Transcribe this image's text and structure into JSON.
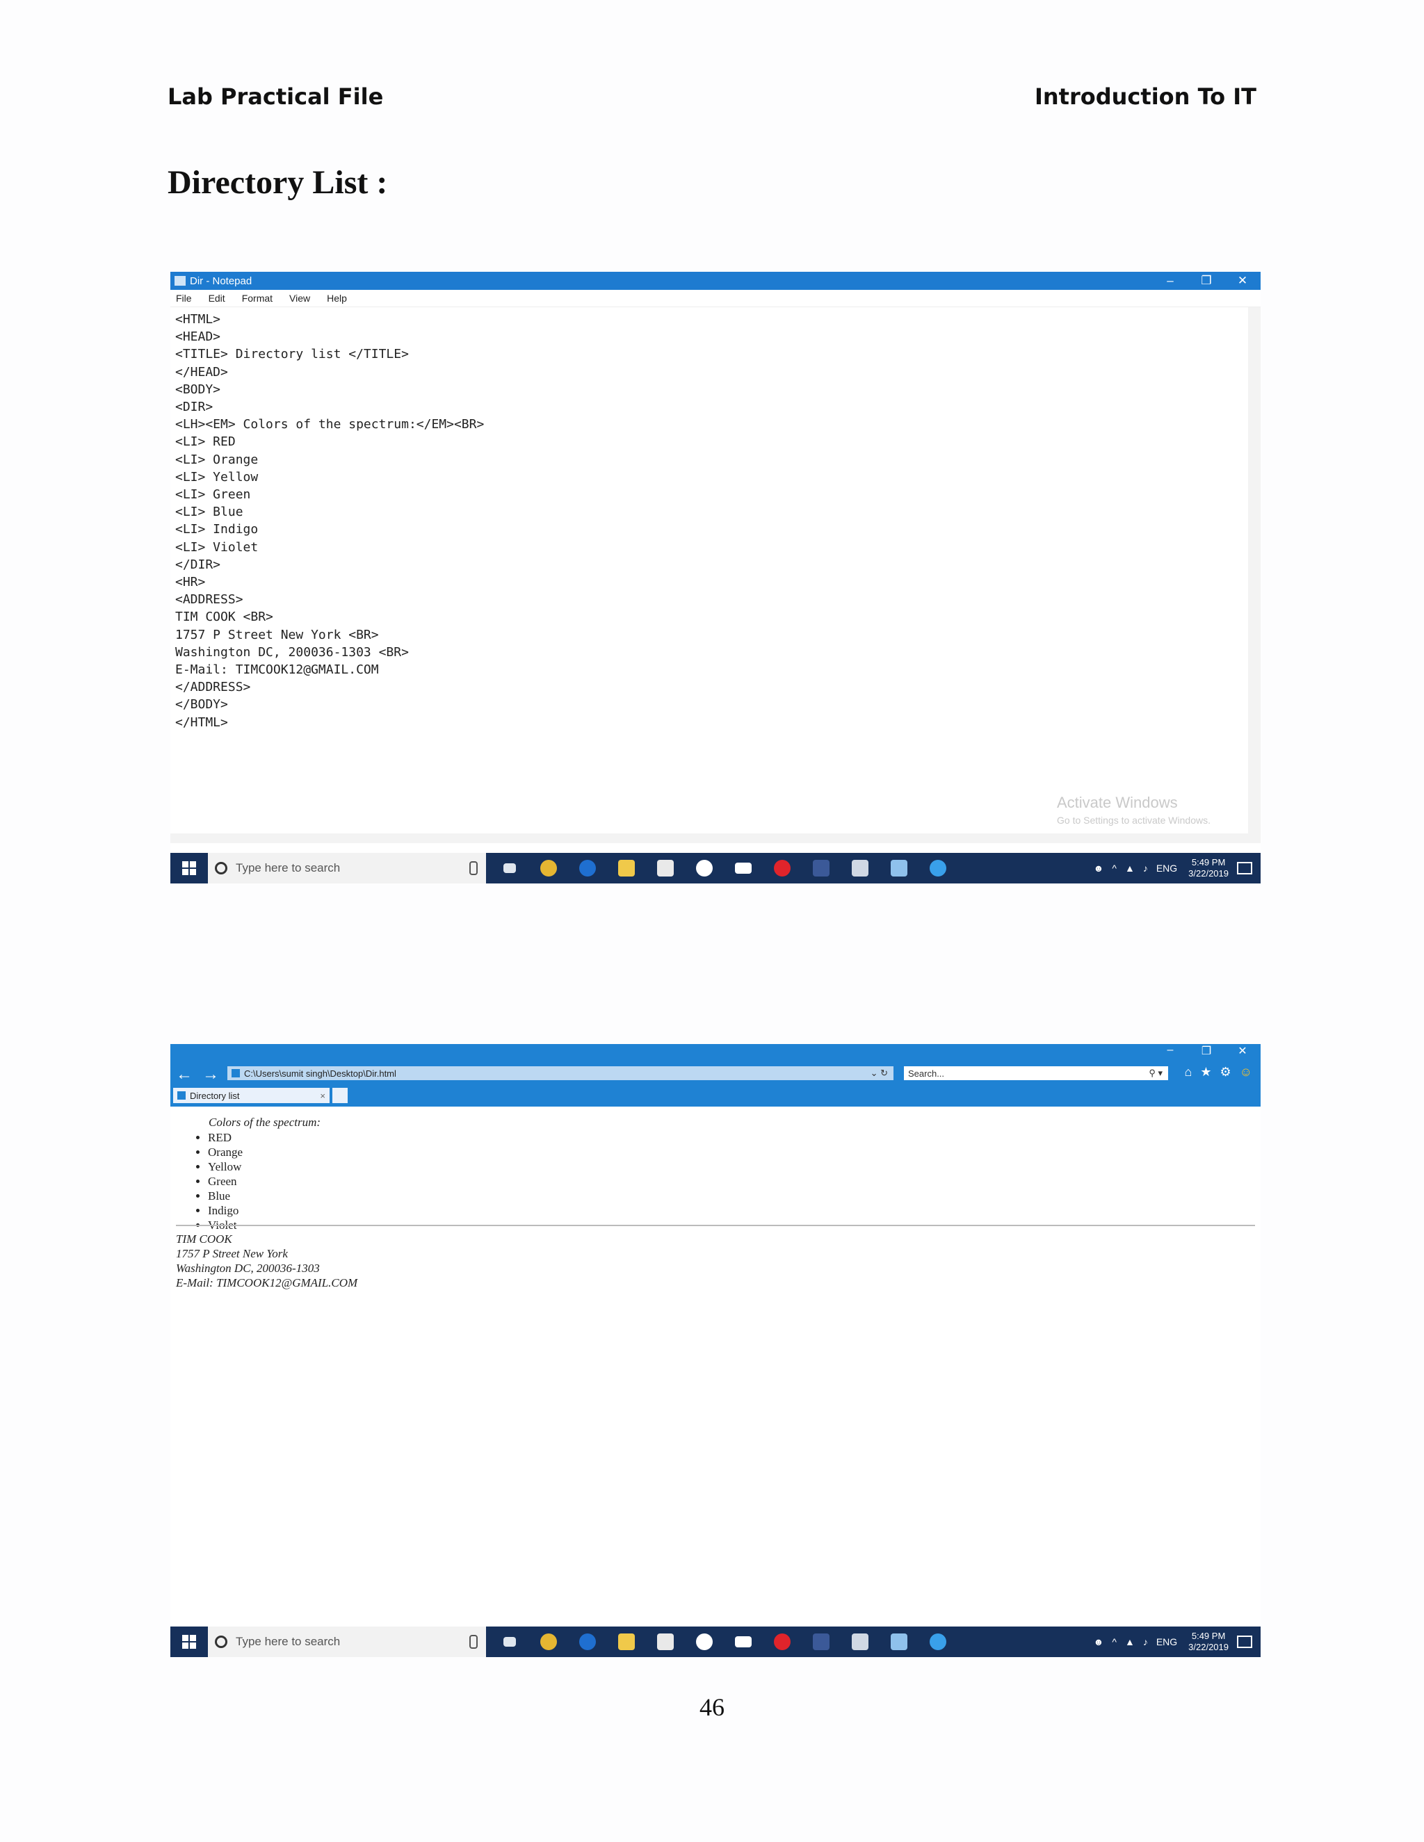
{
  "header": {
    "left": "Lab Practical File",
    "right": "Introduction To IT"
  },
  "heading": "Directory List :",
  "page_number": "46",
  "notepad": {
    "title": "Dir - Notepad",
    "menu": [
      "File",
      "Edit",
      "Format",
      "View",
      "Help"
    ],
    "code_lines": [
      "<HTML>",
      "<HEAD>",
      "<TITLE> Directory list </TITLE>",
      "</HEAD>",
      "<BODY>",
      "<DIR>",
      "<LH><EM> Colors of the spectrum:</EM><BR>",
      "<LI> RED",
      "<LI> Orange",
      "<LI> Yellow",
      "<LI> Green",
      "<LI> Blue",
      "<LI> Indigo",
      "<LI> Violet",
      "</DIR>",
      "<HR>",
      "<ADDRESS>",
      "TIM COOK <BR>",
      "1757 P Street New York <BR>",
      "Washington DC, 200036-1303 <BR>",
      "E-Mail: TIMCOOK12@GMAIL.COM",
      "</ADDRESS>",
      "</BODY>",
      "</HTML>"
    ],
    "window_controls": [
      "–",
      "❐",
      "✕"
    ]
  },
  "watermark": {
    "title": "Activate Windows",
    "subtitle": "Go to Settings to activate Windows."
  },
  "taskbar": {
    "search_placeholder": "Type here to search",
    "lang": "ENG",
    "time": "5:49 PM",
    "date": "3/22/2019",
    "app_icons": [
      "task-view",
      "chrome",
      "edge",
      "file-explorer",
      "store",
      "groove",
      "mail",
      "opera",
      "facebook",
      "calculator",
      "notepad",
      "internet-explorer"
    ]
  },
  "browser": {
    "address": "C:\\Users\\sumit singh\\Desktop\\Dir.html",
    "search_placeholder": "Search...",
    "tab_title": "Directory list",
    "list_header": "Colors of the spectrum:",
    "colors": [
      "RED",
      "Orange",
      "Yellow",
      "Green",
      "Blue",
      "Indigo",
      "Violet"
    ],
    "address_lines": [
      "TIM COOK",
      "1757 P Street New York",
      "Washington DC, 200036-1303",
      "E-Mail: TIMCOOK12@GMAIL.COM"
    ]
  }
}
